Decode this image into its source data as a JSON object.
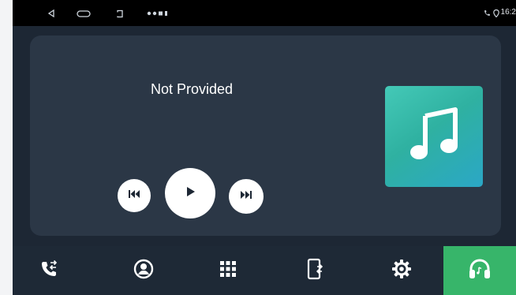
{
  "status_bar": {
    "time": "16:2",
    "left_icons": [
      "back-icon",
      "home-icon",
      "recents-icon",
      "notification-icons"
    ],
    "right_icons": [
      "phone-icon",
      "location-icon"
    ]
  },
  "media": {
    "title": "Not Provided",
    "controls": [
      "previous-icon",
      "play-icon",
      "next-icon"
    ],
    "album_art_icon": "music-note-icon",
    "album_art_colors": [
      "#44c9b7",
      "#2ba7c6"
    ]
  },
  "nav": {
    "items": [
      {
        "icon": "phone-transfer-icon",
        "active": false
      },
      {
        "icon": "user-icon",
        "active": false
      },
      {
        "icon": "apps-grid-icon",
        "active": false
      },
      {
        "icon": "phone-link-icon",
        "active": false
      },
      {
        "icon": "settings-gear-icon",
        "active": false
      },
      {
        "icon": "headphones-icon",
        "active": true
      }
    ],
    "active_color": "#37b56a"
  }
}
